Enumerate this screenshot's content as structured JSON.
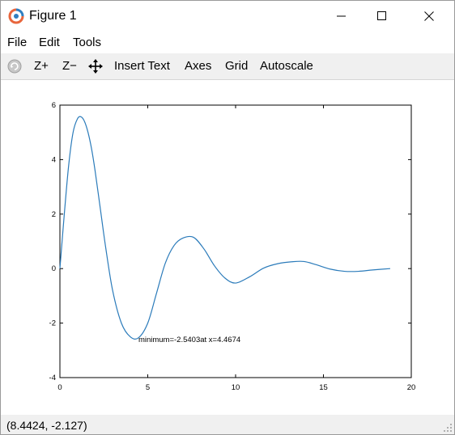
{
  "window": {
    "title": "Figure 1",
    "controls": [
      "minimize",
      "maximize",
      "close"
    ]
  },
  "menubar": {
    "file": "File",
    "edit": "Edit",
    "tools": "Tools"
  },
  "toolbar": {
    "rotate_icon": "rotate-icon",
    "zoom_in": "Z+",
    "zoom_out": "Z−",
    "pan_icon": "pan-icon",
    "insert_text": "Insert Text",
    "axes": "Axes",
    "grid": "Grid",
    "autoscale": "Autoscale"
  },
  "status": {
    "coordinates": "(8.4424, -2.127)"
  },
  "colors": {
    "line": "#2b7bba",
    "toolbar_bg": "#f0f0f0"
  },
  "chart_data": {
    "type": "line",
    "title": "",
    "xlabel": "",
    "ylabel": "",
    "xlim": [
      0,
      20
    ],
    "ylim": [
      -4,
      6
    ],
    "xticks": [
      0,
      5,
      10,
      15,
      20
    ],
    "yticks": [
      -4,
      -2,
      0,
      2,
      4,
      6
    ],
    "grid": false,
    "x": [
      0,
      0.25,
      0.5,
      0.75,
      1.0,
      1.2,
      1.4,
      1.6,
      1.8,
      2.0,
      2.3,
      2.6,
      3.0,
      3.5,
      4.0,
      4.47,
      5.0,
      5.5,
      6.0,
      6.5,
      7.0,
      7.6,
      8.2,
      8.8,
      9.4,
      10.0,
      10.8,
      11.6,
      12.4,
      13.2,
      13.9,
      14.6,
      15.4,
      16.2,
      17.0,
      17.8,
      18.8
    ],
    "y": [
      0,
      2.0,
      3.8,
      5.0,
      5.5,
      5.57,
      5.4,
      5.0,
      4.4,
      3.6,
      2.2,
      0.8,
      -0.8,
      -2.0,
      -2.5,
      -2.54,
      -2.0,
      -0.9,
      0.2,
      0.85,
      1.12,
      1.15,
      0.72,
      0.1,
      -0.35,
      -0.53,
      -0.3,
      0.02,
      0.18,
      0.25,
      0.26,
      0.14,
      -0.02,
      -0.1,
      -0.1,
      -0.05,
      0.0
    ],
    "annotations": [
      {
        "text": "minimum=-2.5403at x=4.4674",
        "x": 4.4674,
        "y": -2.5403
      }
    ]
  }
}
